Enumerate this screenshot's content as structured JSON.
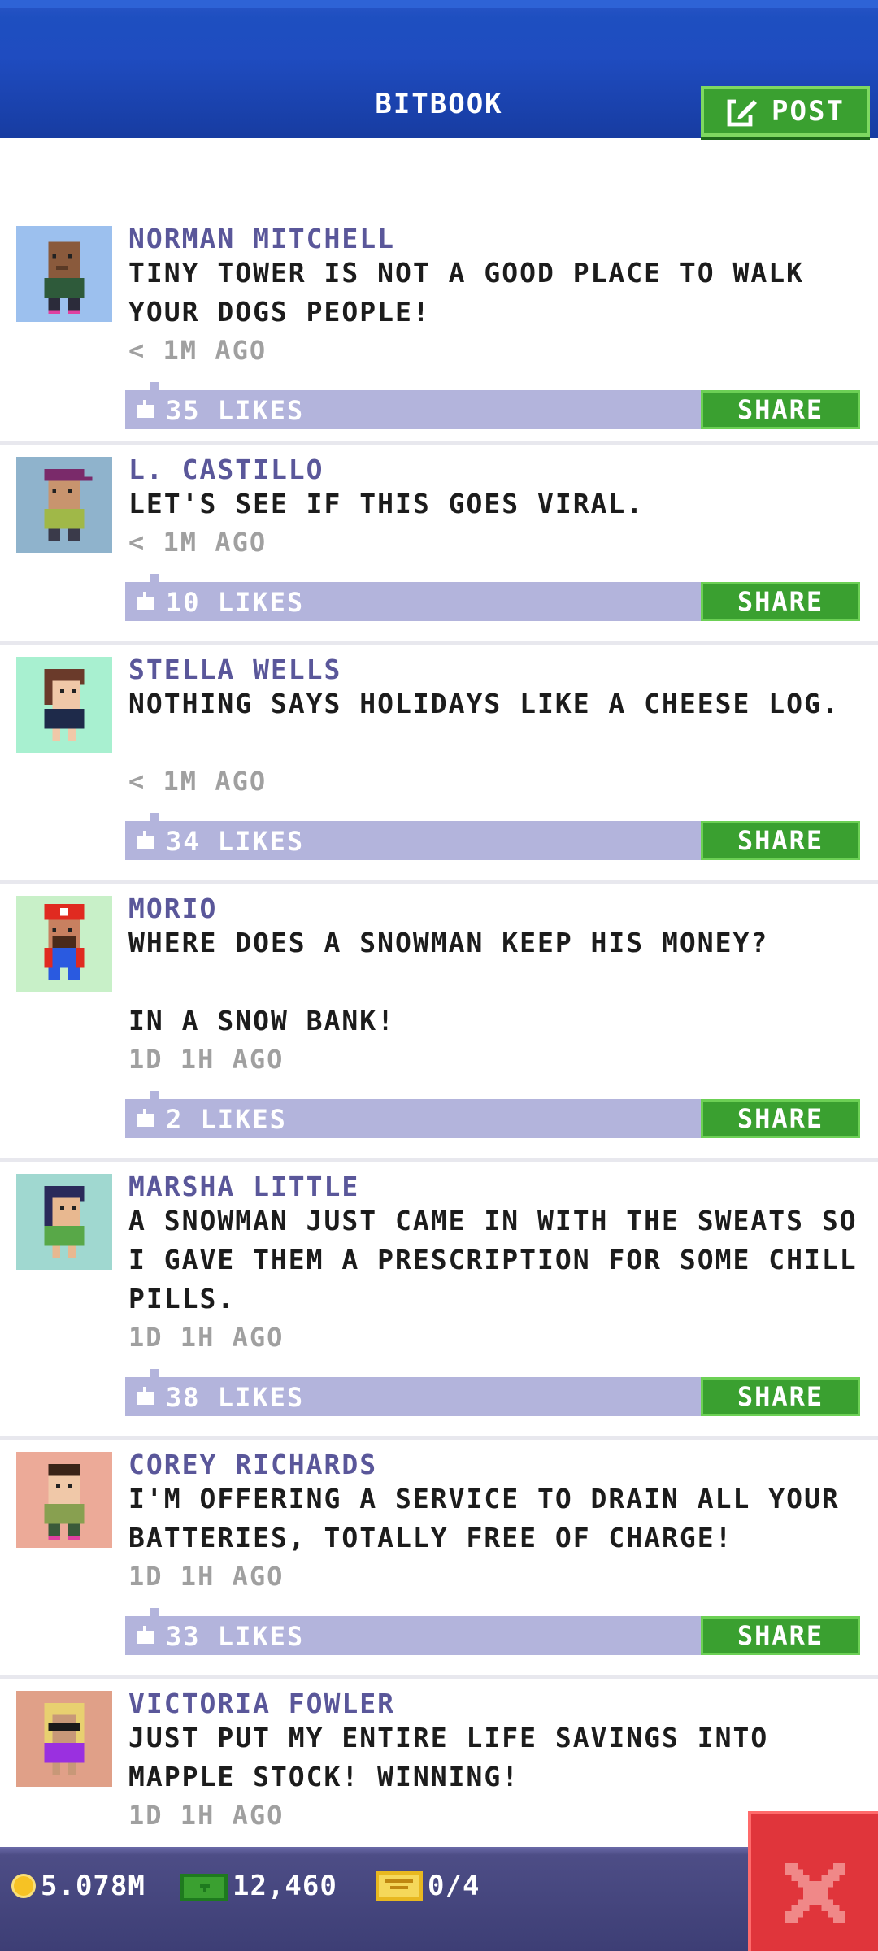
{
  "header": {
    "title": "BITBOOK",
    "post_label": "POST"
  },
  "posts": [
    {
      "author": "NORMAN MITCHELL",
      "text": "TINY TOWER IS NOT A GOOD PLACE TO WALK YOUR DOGS PEOPLE!",
      "time": "< 1M AGO",
      "likes": "35 LIKES",
      "share": "SHARE",
      "avatar_bg": "#9cc0ee",
      "avatar_icon": "avatar-bald-man-icon"
    },
    {
      "author": "L. CASTILLO",
      "text": "LET'S SEE IF THIS GOES VIRAL.",
      "time": "< 1M AGO",
      "likes": "10 LIKES",
      "share": "SHARE",
      "avatar_bg": "#8fb3cc",
      "avatar_icon": "avatar-cap-man-icon"
    },
    {
      "author": "STELLA WELLS",
      "text": "NOTHING SAYS HOLIDAYS LIKE A CHEESE LOG.",
      "time": "< 1M AGO",
      "likes": "34 LIKES",
      "share": "SHARE",
      "avatar_bg": "#a8f0d0",
      "avatar_icon": "avatar-woman-icon"
    },
    {
      "author": "MORIO",
      "text": "WHERE DOES A SNOWMAN KEEP HIS MONEY?\n\nIN A SNOW BANK!",
      "time": "1D 1H AGO",
      "likes": "2 LIKES",
      "share": "SHARE",
      "avatar_bg": "#c8f0c8",
      "avatar_icon": "avatar-plumber-icon"
    },
    {
      "author": "MARSHA LITTLE",
      "text": "A SNOWMAN JUST CAME IN WITH THE SWEATS SO I GAVE THEM A PRESCRIPTION FOR SOME CHILL PILLS.",
      "time": "1D 1H AGO",
      "likes": "38 LIKES",
      "share": "SHARE",
      "avatar_bg": "#a0d8d0",
      "avatar_icon": "avatar-dark-hair-woman-icon"
    },
    {
      "author": "COREY RICHARDS",
      "text": "I'M OFFERING A SERVICE TO DRAIN ALL YOUR BATTERIES, TOTALLY FREE OF CHARGE!",
      "time": "1D 1H AGO",
      "likes": "33 LIKES",
      "share": "SHARE",
      "avatar_bg": "#ecaa98",
      "avatar_icon": "avatar-man-icon"
    },
    {
      "author": "VICTORIA FOWLER",
      "text": "JUST PUT MY ENTIRE LIFE SAVINGS INTO MAPPLE STOCK! WINNING!",
      "time": "1D 1H AGO",
      "likes": "",
      "share": "",
      "avatar_bg": "#e0a088",
      "avatar_icon": "avatar-sunglasses-woman-icon"
    }
  ],
  "bottom_bar": {
    "coins": "5.078M",
    "bux": "12,460",
    "tickets": "0/4"
  },
  "colors": {
    "header_blue": "#1e4fc0",
    "share_green": "#3aa030",
    "likes_bar": "#b3b4dc",
    "author_purple": "#5a579a",
    "close_red": "#e0353b"
  }
}
